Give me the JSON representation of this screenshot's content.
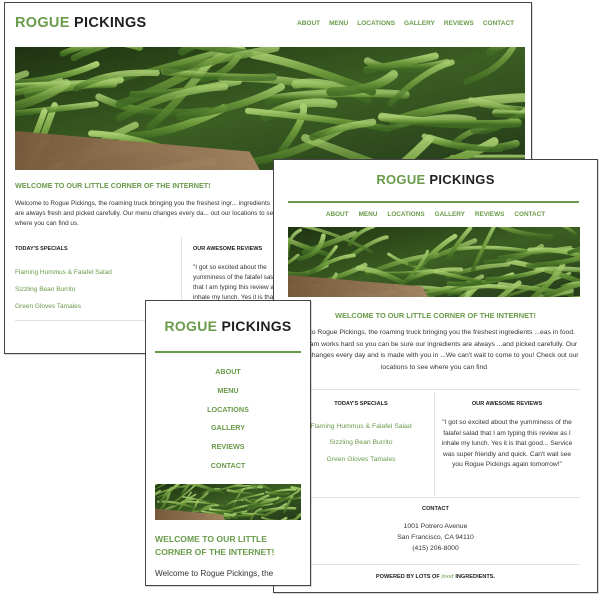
{
  "brand": {
    "part1": "ROGUE",
    "part2": "PICKINGS"
  },
  "nav": [
    "ABOUT",
    "MENU",
    "LOCATIONS",
    "GALLERY",
    "REVIEWS",
    "CONTACT"
  ],
  "welcome_heading": "WELCOME TO OUR LITTLE CORNER OF THE INTERNET!",
  "desktop": {
    "intro": "Welcome to Rogue Pickings, the roaming truck bringing you the freshest ingr... ingredients are always fresh and picked carefully. Our menu changes every da... out our locations to see where you can find us.",
    "review": "\"I got so excited about the yumminess of the falafel salad that I am typing this review as I inhale my lunch. Yes it is that good... Service was super friendly and quick. Can't wait see you"
  },
  "tablet": {
    "intro": "...me to Rogue Pickings, the roaming truck bringing you the freshest ingredients ...eas in food. Our team works hard so you can be sure our ingredients are always ...and picked carefully. Our menu changes every day and is made with you in ...We can't wait to come to you! Check out our locations to see where you can find"
  },
  "mobile": {
    "intro": "Welcome to Rogue Pickings, the"
  },
  "specials_title": "TODAY'S SPECIALS",
  "specials": [
    "Flaming Hummus & Falafel Salad",
    "Sizzling Bean Burrito",
    "Green Gloves Tamales"
  ],
  "reviews_title": "OUR AWESOME REVIEWS",
  "review_full": "\"I got so excited about the yumminess of the falafel salad that I am typing this review as I inhale my lunch. Yes it is that good... Service was super friendly and quick. Can't wait see you Rogue Pickings again tomorrow!\"",
  "contact": {
    "title": "CONTACT",
    "lines": [
      "1001 Potrero Avenue",
      "San Francisco, CA 94110",
      "(415) 206-8000"
    ]
  },
  "footer": {
    "pre": "POWERED BY LOTS OF",
    "food": "food",
    "post": "INGREDIENTS."
  },
  "colors": {
    "accent": "#6a9b4a",
    "text": "#333333"
  }
}
